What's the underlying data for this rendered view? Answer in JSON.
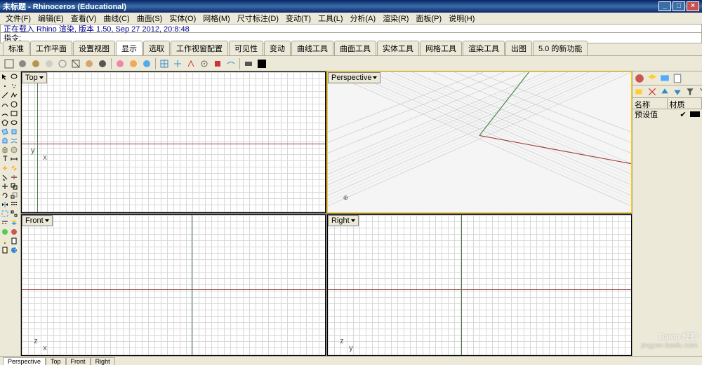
{
  "window": {
    "title": "未标题 - Rhinoceros (Educational)"
  },
  "menu": [
    "文件(F)",
    "编辑(E)",
    "查看(V)",
    "曲线(C)",
    "曲面(S)",
    "实体(O)",
    "网格(M)",
    "尺寸标注(D)",
    "变动(T)",
    "工具(L)",
    "分析(A)",
    "渲染(R)",
    "面板(P)",
    "说明(H)"
  ],
  "info_line": "正在载入 Rhino 渲染, 版本 1.50, Sep 27 2012, 20:8:48",
  "cmd_prompt": "指令:",
  "tabs": [
    "标准",
    "工作平面",
    "设置视图",
    "显示",
    "选取",
    "工作视窗配置",
    "可见性",
    "变动",
    "曲线工具",
    "曲面工具",
    "实体工具",
    "网格工具",
    "渲染工具",
    "出图",
    "5.0 的新功能"
  ],
  "active_tab_index": 3,
  "viewports": {
    "top_left": "Top",
    "top_right": "Perspective",
    "bottom_left": "Front",
    "bottom_right": "Right"
  },
  "right_panel": {
    "header_col1": "名称",
    "header_col2": "材质",
    "default_layer": "预设值"
  },
  "status_tabs": [
    "Perspective",
    "Top",
    "Front",
    "Right"
  ],
  "watermark": {
    "line1": "Baidu 经验",
    "line2": "jingyan.baidu.com"
  },
  "origin_labels": {
    "x": "x",
    "y": "y",
    "z": "z"
  },
  "colors": {
    "titlebar": "#0a246a",
    "panel": "#ece9d8",
    "axis_x": "#8b3a3a",
    "axis_y": "#4a7a4a"
  }
}
